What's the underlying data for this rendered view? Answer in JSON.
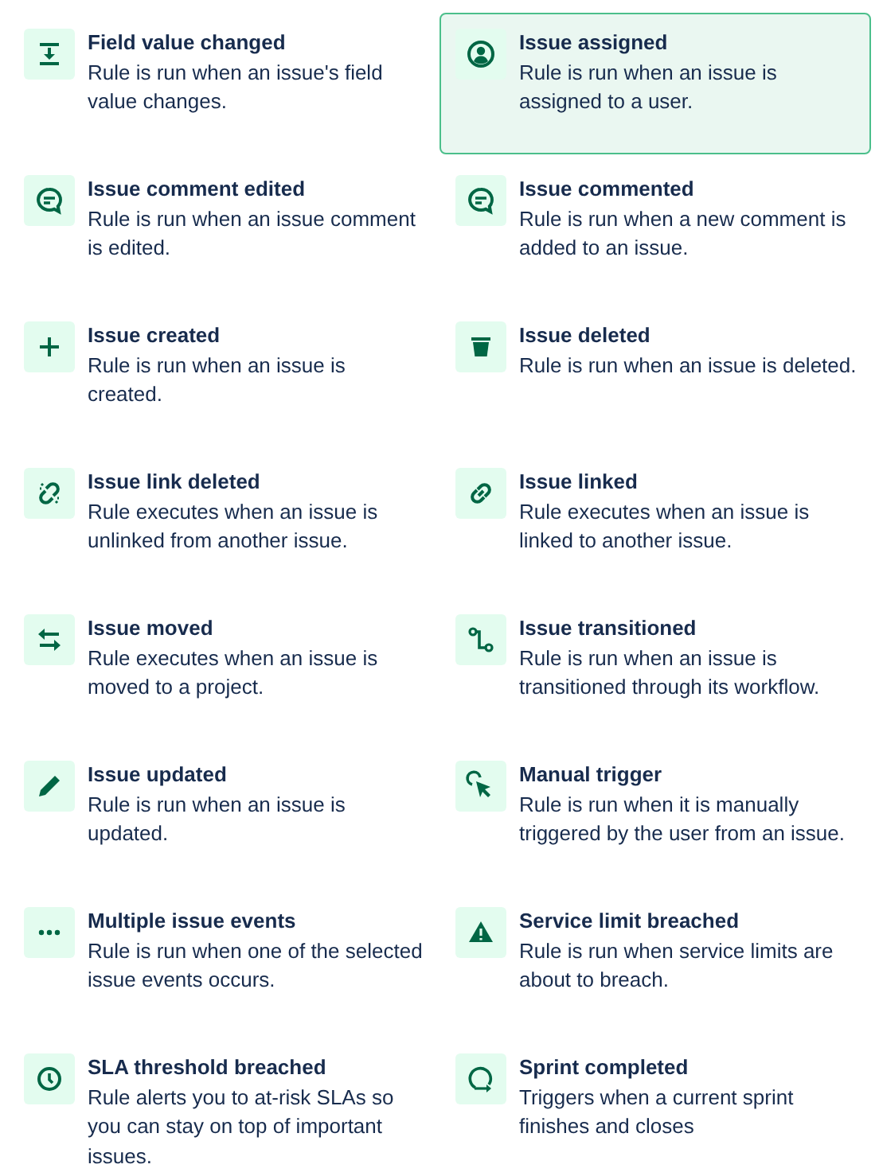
{
  "triggers": [
    {
      "title": "Field value changed",
      "description": "Rule is run when an issue's field value changes.",
      "selected": false
    },
    {
      "title": "Issue assigned",
      "description": "Rule is run when an issue is assigned to a user.",
      "selected": true
    },
    {
      "title": "Issue comment edited",
      "description": "Rule is run when an issue comment is edited.",
      "selected": false
    },
    {
      "title": "Issue commented",
      "description": "Rule is run when a new comment is added to an issue.",
      "selected": false
    },
    {
      "title": "Issue created",
      "description": "Rule is run when an issue is created.",
      "selected": false
    },
    {
      "title": "Issue deleted",
      "description": "Rule is run when an issue is deleted.",
      "selected": false
    },
    {
      "title": "Issue link deleted",
      "description": "Rule executes when an issue is unlinked from another issue.",
      "selected": false
    },
    {
      "title": "Issue linked",
      "description": "Rule executes when an issue is linked to another issue.",
      "selected": false
    },
    {
      "title": "Issue moved",
      "description": "Rule executes when an issue is moved to a project.",
      "selected": false
    },
    {
      "title": "Issue transitioned",
      "description": "Rule is run when an issue is transitioned through its workflow.",
      "selected": false
    },
    {
      "title": "Issue updated",
      "description": "Rule is run when an issue is updated.",
      "selected": false
    },
    {
      "title": "Manual trigger",
      "description": "Rule is run when it is manually triggered by the user from an issue.",
      "selected": false
    },
    {
      "title": "Multiple issue events",
      "description": "Rule is run when one of the selected issue events occurs.",
      "selected": false
    },
    {
      "title": "Service limit breached",
      "description": "Rule is run when service limits are about to breach.",
      "selected": false
    },
    {
      "title": "SLA threshold breached",
      "description": "Rule alerts you to at-risk SLAs so you can stay on top of important issues.",
      "selected": false
    },
    {
      "title": "Sprint completed",
      "description": "Triggers when a current sprint finishes and closes",
      "selected": false
    }
  ]
}
